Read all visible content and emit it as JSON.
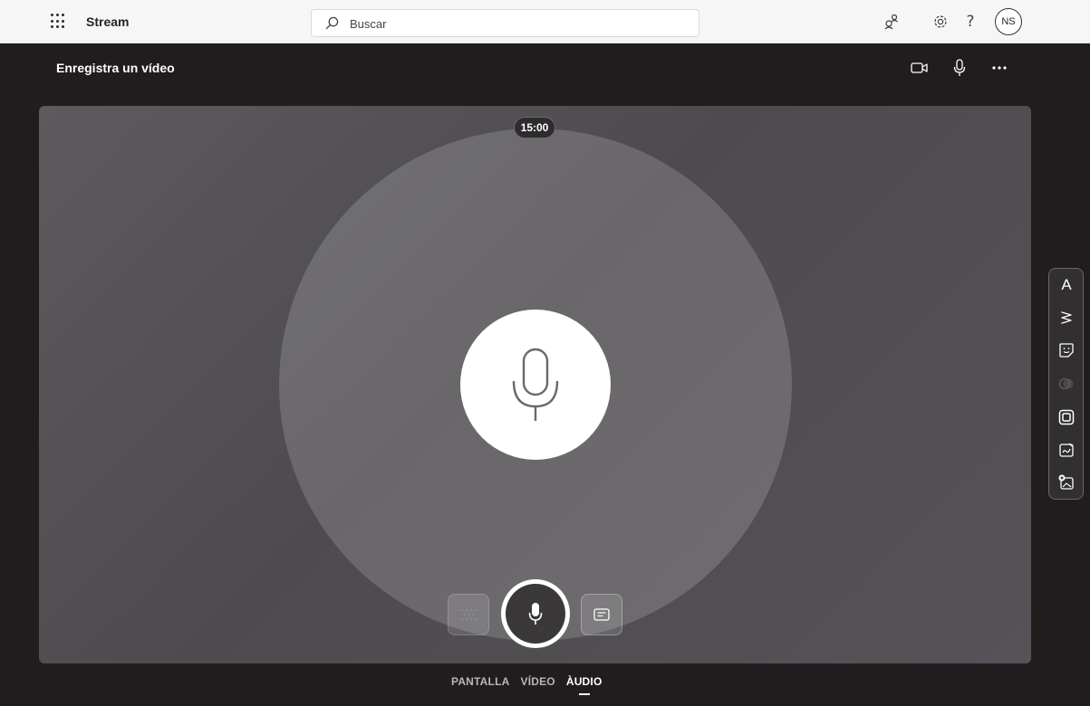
{
  "topbar": {
    "app_name": "Stream",
    "search_placeholder": "Buscar",
    "avatar_initials": "NS",
    "help_glyph": "?",
    "icons": [
      "app-launcher-icon",
      "search-icon",
      "people-icon",
      "settings-icon",
      "help-icon"
    ]
  },
  "recorder": {
    "title": "Enregistra un vídeo",
    "header_icons": [
      "camera-icon",
      "microphone-icon",
      "more-options-icon"
    ],
    "timer": "15:00"
  },
  "controls": {
    "left": "effects-icon",
    "center": "record-microphone-icon",
    "right": "teleprompter-icon"
  },
  "modes": [
    {
      "label": "PANTALLA",
      "active": false
    },
    {
      "label": "VÍDEO",
      "active": false
    },
    {
      "label": "ÀUDIO",
      "active": true
    }
  ],
  "side_tools": {
    "text_glyph": "A",
    "icons": [
      "text-icon",
      "pen-icon",
      "sticker-icon",
      "filter-icon",
      "frame-icon",
      "backdrop-icon",
      "add-image-icon"
    ]
  },
  "colors": {
    "background": "#211d1e",
    "topbar": "#f6f6f6",
    "stage": "#545255",
    "accent": "#ffffff"
  }
}
